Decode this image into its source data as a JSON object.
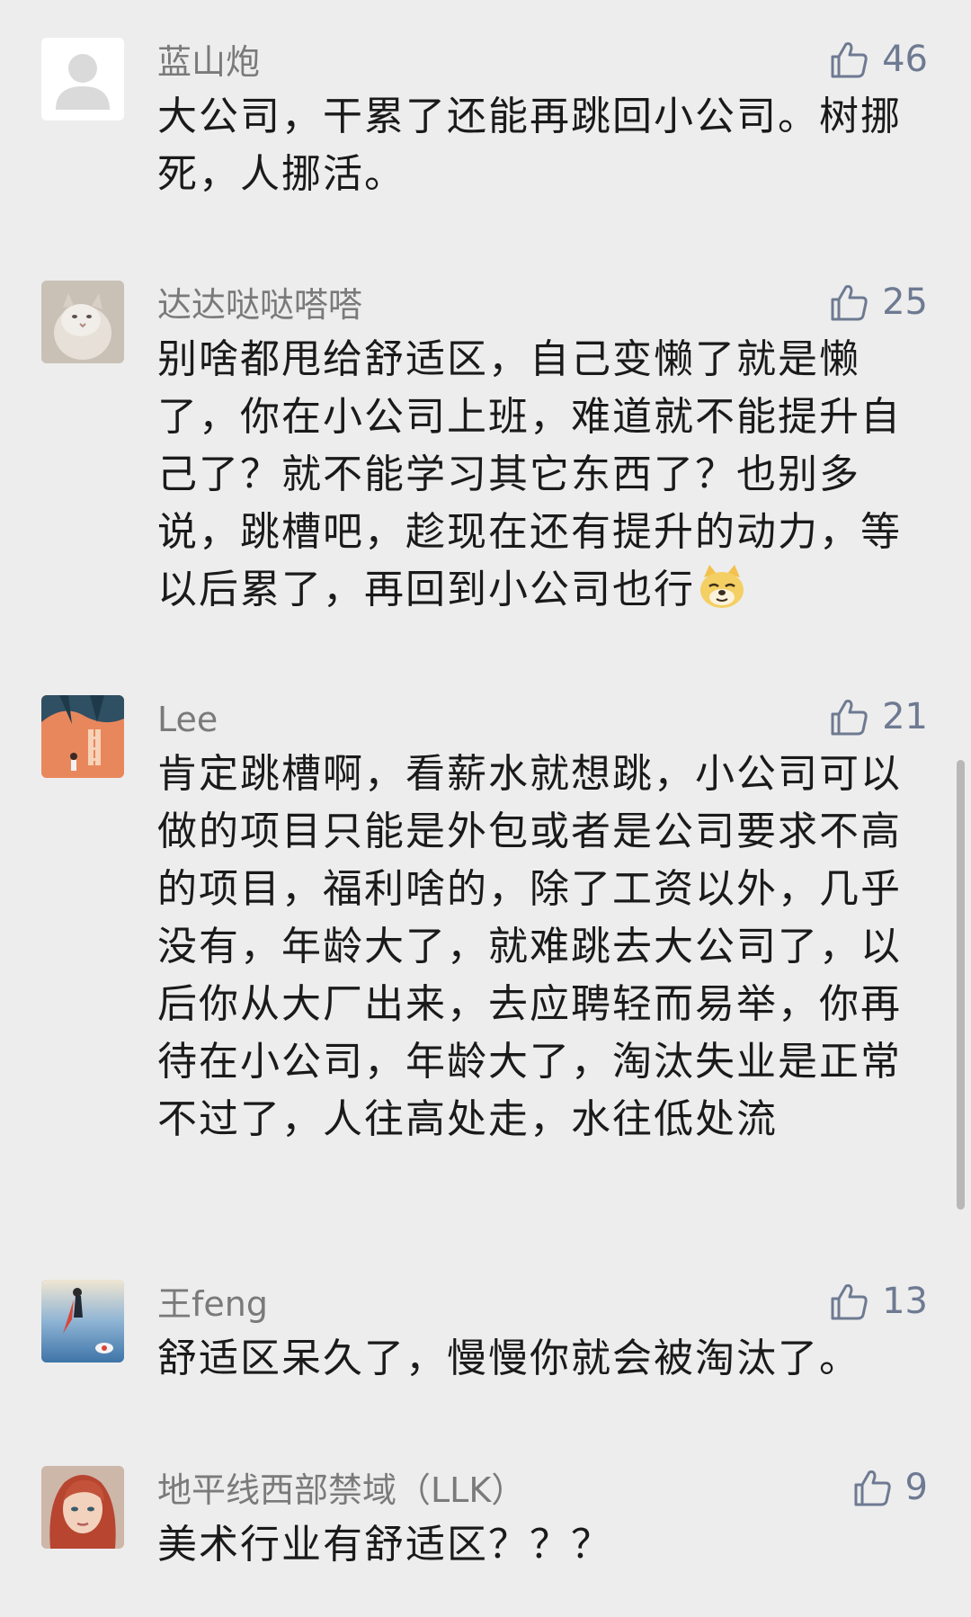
{
  "comments": [
    {
      "username": "蓝山炮",
      "likes": "46",
      "text": "大公司，干累了还能再跳回小公司。树挪死，人挪活。",
      "avatar": "default-person-avatar"
    },
    {
      "username": "达达哒哒嗒嗒",
      "likes": "25",
      "text": "别啥都甩给舒适区，自己变懒了就是懒了，你在小公司上班，难道就不能提升自己了？就不能学习其它东西了？也别多说，跳槽吧，趁现在还有提升的动力，等以后累了，再回到小公司也行",
      "avatar": "cat-photo-avatar",
      "trailing_emoji": "doge-emoji"
    },
    {
      "username": "Lee",
      "likes": "21",
      "text": "肯定跳槽啊，看薪水就想跳，小公司可以做的项目只能是外包或者是公司要求不高的项目，福利啥的，除了工资以外，几乎没有，年龄大了，就难跳去大公司了，以后你从大厂出来，去应聘轻而易举，你再待在小公司，年龄大了，淘汰失业是正常不过了，人往高处走，水往低处流",
      "avatar": "illustration-avatar"
    },
    {
      "username": "王feng",
      "likes": "13",
      "text": "舒适区呆久了，慢慢你就会被淘汰了。",
      "avatar": "sky-illustration-avatar"
    },
    {
      "username": "地平线西部禁域（LLK）",
      "likes": "9",
      "text": "美术行业有舒适区？？？",
      "avatar": "red-hair-character-avatar"
    }
  ],
  "colors": {
    "background": "#ededed",
    "username": "#7a7a7a",
    "like_accent": "#6e7a92",
    "text": "#1a1a1a"
  },
  "icons": {
    "like": "thumbs-up-icon"
  }
}
